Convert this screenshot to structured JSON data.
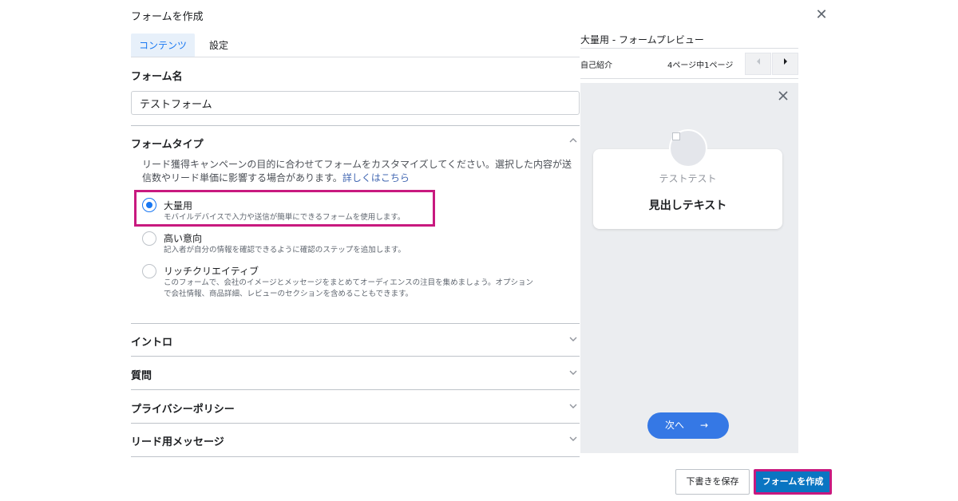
{
  "dialog": {
    "title": "フォームを作成",
    "close_glyph": "✕"
  },
  "tabs": [
    {
      "label": "コンテンツ",
      "active": true
    },
    {
      "label": "設定",
      "active": false
    }
  ],
  "form_name": {
    "label": "フォーム名",
    "value": "テストフォーム"
  },
  "form_type": {
    "label": "フォームタイプ",
    "description_line1": "リード獲得キャンペーンの目的に合わせてフォームをカスタマイズしてください。選択した内容が送",
    "description_line2": "信数やリード単価に影響する場合があります。",
    "learn_more": "詳しくはこちら",
    "options": [
      {
        "title": "大量用",
        "desc": "モバイルデバイスで入力や送信が簡単にできるフォームを使用します。",
        "selected": true
      },
      {
        "title": "高い意向",
        "desc": "記入者が自分の情報を確認できるように確認のステップを追加します。",
        "selected": false
      },
      {
        "title": "リッチクリエイティブ",
        "desc": "このフォームで、会社のイメージとメッセージをまとめてオーディエンスの注目を集めましょう。オプション",
        "desc2": "で会社情報、商品詳細、レビューのセクションを含めることもできます。",
        "selected": false
      }
    ]
  },
  "accordion": [
    {
      "label": "イントロ"
    },
    {
      "label": "質問"
    },
    {
      "label": "プライバシーポリシー"
    },
    {
      "label": "リード用メッセージ"
    }
  ],
  "preview": {
    "title": "大量用 - フォームプレビュー",
    "section": "自己紹介",
    "page_indicator": "4ページ中1ページ",
    "card_subtitle": "テストテスト",
    "card_heading": "見出しテキスト",
    "next_label": "次へ",
    "next_arrow": "→"
  },
  "footer": {
    "save_draft": "下書きを保存",
    "create": "フォームを作成"
  },
  "colors": {
    "accent": "#1877f2",
    "highlight": "#c8197f",
    "primary_button": "#0a75c2"
  }
}
